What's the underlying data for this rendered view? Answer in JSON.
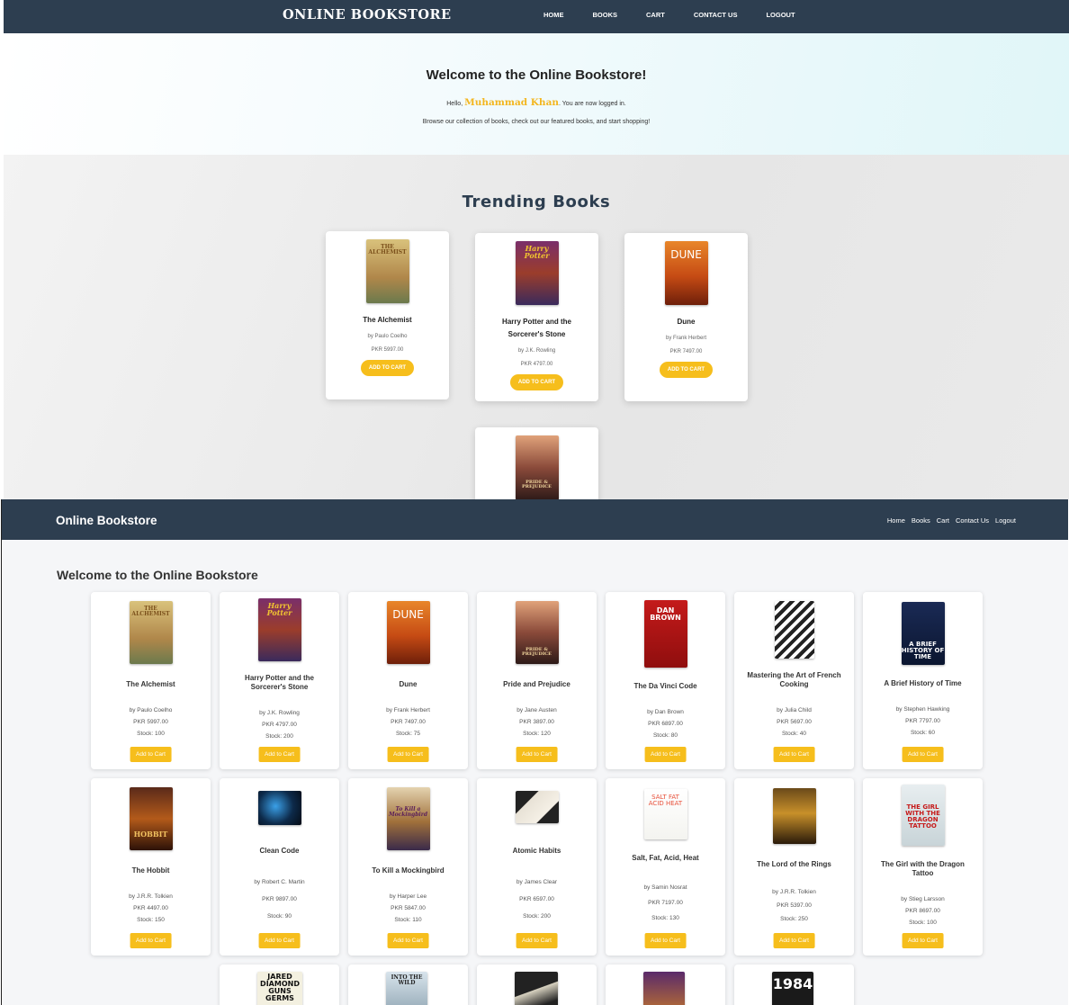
{
  "top": {
    "brand": "ONLINE BOOKSTORE",
    "nav": [
      "HOME",
      "BOOKS",
      "CART",
      "CONTACT US",
      "LOGOUT"
    ],
    "hero": {
      "title": "Welcome to the Online Bookstore!",
      "hello_prefix": "Hello, ",
      "user_name": "Muhammad Khan",
      "hello_suffix": ". You are now logged in.",
      "browse": "Browse our collection of books, check out our featured books, and start shopping!"
    },
    "trending_title": "Trending Books",
    "trending": [
      {
        "title": "The Alchemist",
        "author": "by Paulo Coelho",
        "price": "PKR 5997.00",
        "button": "ADD TO CART"
      },
      {
        "title": "Harry Potter and the Sorcerer's Stone",
        "author": "by J.K. Rowling",
        "price": "PKR 4797.00",
        "button": "ADD TO CART"
      },
      {
        "title": "Dune",
        "author": "by Frank Herbert",
        "price": "PKR 7497.00",
        "button": "ADD TO CART"
      }
    ]
  },
  "bottom": {
    "brand": "Online Bookstore",
    "nav": [
      "Home",
      "Books",
      "Cart",
      "Contact Us",
      "Logout"
    ],
    "heading": "Welcome to the Online Bookstore",
    "books": [
      {
        "title": "The Alchemist",
        "author": "by Paulo Coelho",
        "price": "PKR 5997.00",
        "stock": "Stock: 100",
        "button": "Add to Cart"
      },
      {
        "title": "Harry Potter and the Sorcerer's Stone",
        "author": "by J.K. Rowling",
        "price": "PKR 4797.00",
        "stock": "Stock: 200",
        "button": "Add to Cart"
      },
      {
        "title": "Dune",
        "author": "by Frank Herbert",
        "price": "PKR 7497.00",
        "stock": "Stock: 75",
        "button": "Add to Cart"
      },
      {
        "title": "Pride and Prejudice",
        "author": "by Jane Austen",
        "price": "PKR 3897.00",
        "stock": "Stock: 120",
        "button": "Add to Cart"
      },
      {
        "title": "The Da Vinci Code",
        "author": "by Dan Brown",
        "price": "PKR 6897.00",
        "stock": "Stock: 80",
        "button": "Add to Cart"
      },
      {
        "title": "Mastering the Art of French Cooking",
        "author": "by Julia Child",
        "price": "PKR 5697.00",
        "stock": "Stock: 40",
        "button": "Add to Cart"
      },
      {
        "title": "A Brief History of Time",
        "author": "by Stephen Hawking",
        "price": "PKR 7797.00",
        "stock": "Stock: 60",
        "button": "Add to Cart"
      },
      {
        "title": "The Hobbit",
        "author": "by J.R.R. Tolkien",
        "price": "PKR 4497.00",
        "stock": "Stock: 150",
        "button": "Add to Cart"
      },
      {
        "title": "Clean Code",
        "author": "by Robert C. Martin",
        "price": "PKR 9897.00",
        "stock": "Stock: 90",
        "button": "Add to Cart"
      },
      {
        "title": "To Kill a Mockingbird",
        "author": "by Harper Lee",
        "price": "PKR 5847.00",
        "stock": "Stock: 110",
        "button": "Add to Cart"
      },
      {
        "title": "Atomic Habits",
        "author": "by James Clear",
        "price": "PKR 6597.00",
        "stock": "Stock: 200",
        "button": "Add to Cart"
      },
      {
        "title": "Salt, Fat, Acid, Heat",
        "author": "by Samin Nosrat",
        "price": "PKR 7197.00",
        "stock": "Stock: 130",
        "button": "Add to Cart"
      },
      {
        "title": "The Lord of the Rings",
        "author": "by J.R.R. Tolkien",
        "price": "PKR 5397.00",
        "stock": "Stock: 250",
        "button": "Add to Cart"
      },
      {
        "title": "The Girl with the Dragon Tattoo",
        "author": "by Stieg Larsson",
        "price": "PKR 8697.00",
        "stock": "Stock: 100",
        "button": "Add to Cart"
      }
    ]
  },
  "covers": {
    "alchemist": {
      "text": "THE ALCHEMIST"
    },
    "harry_potter": {
      "text": "Harry Potter"
    },
    "dune": {
      "text": "DUNE"
    },
    "pride": {
      "text": "PRIDE & PREJUDICE"
    },
    "davinci": {
      "text": "DAN BROWN"
    },
    "brief": {
      "text": "A BRIEF HISTORY OF TIME"
    },
    "hobbit": {
      "text": "HOBBIT"
    },
    "mockingbird": {
      "text": "To Kill a Mockingbird"
    },
    "salt": {
      "text": "SALT FAT ACID HEAT"
    },
    "dragon": {
      "text": "THE GIRL WITH THE DRAGON TATTOO"
    },
    "jared": {
      "text": "JARED DIAMOND GUNS GERMS"
    },
    "wild": {
      "text": "INTO THE WILD"
    },
    "nineteen": {
      "text": "1984"
    }
  },
  "colors": {
    "navbar": "#2d3e50",
    "accent": "#f6be1c",
    "username": "#f3b61f"
  }
}
